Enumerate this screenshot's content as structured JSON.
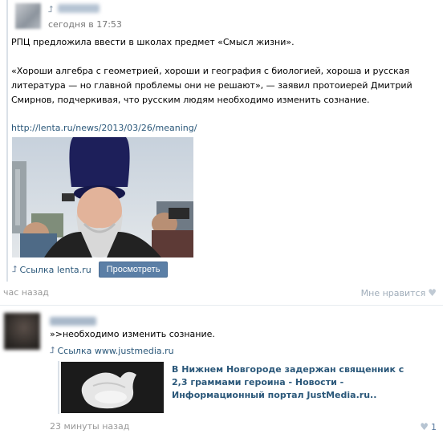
{
  "repost": {
    "source_name": "Глазной",
    "source_time": "сегодня в 17:53",
    "text_line1": "РПЦ предложила ввести в школах предмет «Смысл жизни».",
    "text_quote": "«Хороши алгебра с геометрией, хороши и география с биологией, хороша и русская литература — но главной проблемы они не решают», — заявил протоиерей Дмитрий Смирнов, подчеркивая, что русским людям необходимо изменить сознание.",
    "link": "http://lenta.ru/news/2013/03/26/meaning/",
    "attachment_label": "Ссылка lenta.ru",
    "view_button": "Просмотреть"
  },
  "post_footer": {
    "time_ago": "час назад",
    "like_label": "Мне нравится"
  },
  "comment": {
    "author": "Роман Розанов",
    "text": "»>необходимо изменить сознание.",
    "attachment_label": "Ссылка www.justmedia.ru",
    "preview_title": "В Нижнем Новгороде задержан священник с 2,3 граммами героина - Новости - Информационный портал JustMedia.ru..",
    "time_ago": "23 минуты назад",
    "like_count": "1"
  },
  "icons": {
    "repost": "repost-arrow-icon",
    "link": "link-icon",
    "like": "heart-icon"
  },
  "colors": {
    "link": "#2b587a",
    "button": "#5b7fa6",
    "muted": "#999999"
  }
}
